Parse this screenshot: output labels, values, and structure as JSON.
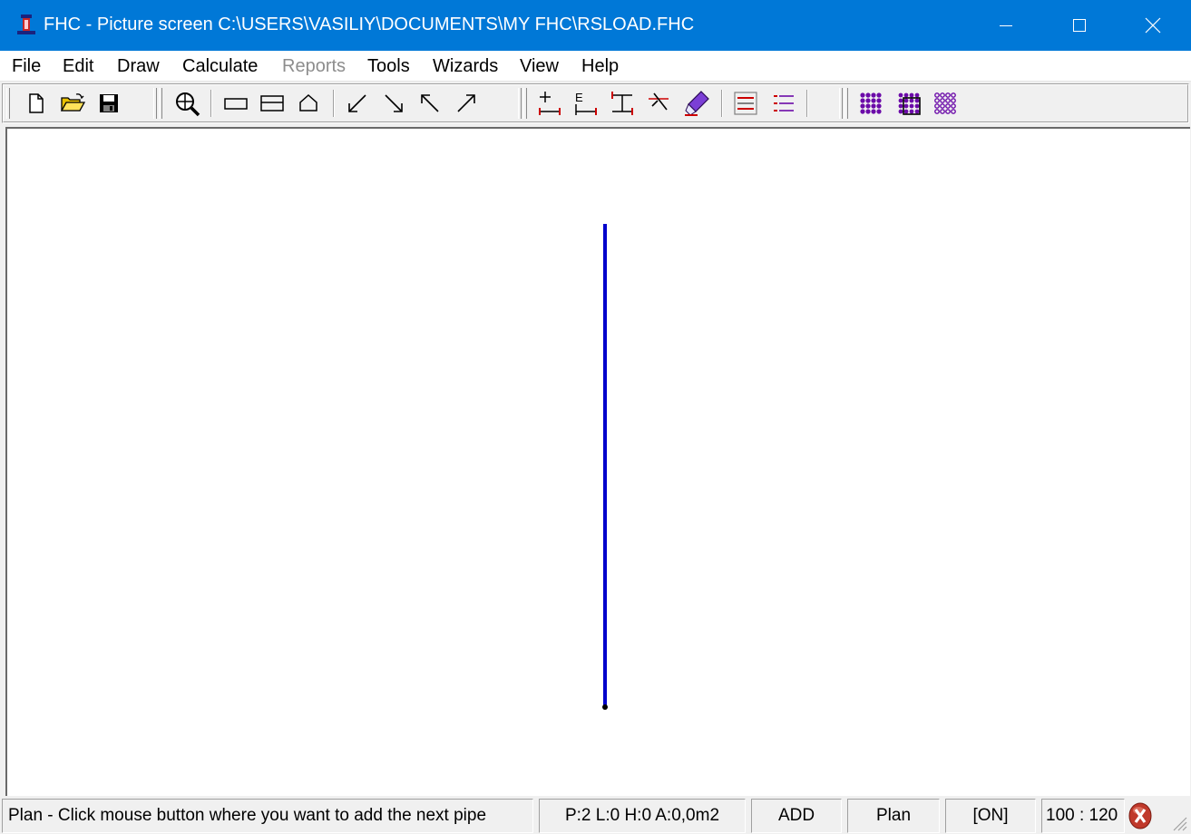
{
  "window": {
    "title": "FHC - Picture screen C:\\USERS\\VASILIY\\DOCUMENTS\\MY FHC\\RSLOAD.FHC"
  },
  "menu": [
    {
      "label": "File",
      "enabled": true
    },
    {
      "label": "Edit",
      "enabled": true
    },
    {
      "label": "Draw",
      "enabled": true
    },
    {
      "label": "Calculate",
      "enabled": true
    },
    {
      "label": "Reports",
      "enabled": false
    },
    {
      "label": "Tools",
      "enabled": true
    },
    {
      "label": "Wizards",
      "enabled": true
    },
    {
      "label": "View",
      "enabled": true
    },
    {
      "label": "Help",
      "enabled": true
    }
  ],
  "toolbar": {
    "icons": [
      "new-file-icon",
      "open-folder-icon",
      "save-icon",
      "zoom-icon",
      "rectangle-icon",
      "split-rectangle-icon",
      "house-outline-icon",
      "arrow-down-left-icon",
      "arrow-down-right-icon",
      "arrow-up-left-icon",
      "arrow-up-right-icon",
      "add-pipe-icon",
      "end-pipe-icon",
      "tee-pipe-icon",
      "cut-pipe-icon",
      "highlighter-icon",
      "list-red-icon",
      "list-lines-icon",
      "sprinkler-grid-icon",
      "sprinkler-grid-selected-icon",
      "sprinkler-grid-outline-icon"
    ]
  },
  "status": {
    "message": "Plan - Click mouse button where you want to add the next pipe",
    "stats": "P:2 L:0 H:0 A:0,0m2",
    "mode": "ADD",
    "view": "Plan",
    "toggle": "[ON]",
    "scale": "100 : 120"
  },
  "colors": {
    "titlebar": "#0078d7",
    "pipe": "#0000cc",
    "icon_purple": "#6b0aa8",
    "icon_red": "#cc0000"
  }
}
